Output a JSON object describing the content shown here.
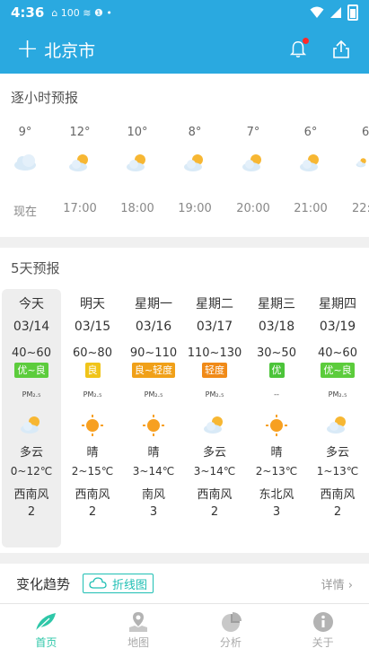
{
  "status": {
    "time": "4:36",
    "noti": "⌂ 100 ≋ ❶ •"
  },
  "header": {
    "add": "+",
    "city": "北京市"
  },
  "hourly": {
    "title": "逐小时预报",
    "items": [
      {
        "temp": "9°",
        "label": "现在",
        "icon": "cloudy-icon"
      },
      {
        "temp": "12°",
        "label": "17:00",
        "icon": "partly-cloudy-icon"
      },
      {
        "temp": "10°",
        "label": "18:00",
        "icon": "partly-cloudy-icon"
      },
      {
        "temp": "8°",
        "label": "19:00",
        "icon": "partly-cloudy-icon"
      },
      {
        "temp": "7°",
        "label": "20:00",
        "icon": "partly-cloudy-icon"
      },
      {
        "temp": "6°",
        "label": "21:00",
        "icon": "partly-cloudy-icon"
      },
      {
        "temp": "6",
        "label": "22:",
        "icon": "partly-cloudy-icon"
      }
    ]
  },
  "daily": {
    "title": "5天预报",
    "days": [
      {
        "name": "今天",
        "date": "03/14",
        "aqi": "40~60",
        "badge": "优~良",
        "badge_color": "#5ccc3c",
        "pm": "PM₂.₅",
        "icon": "partly-cloudy-icon",
        "cond": "多云",
        "temp": "0~12℃",
        "wind": "西南风",
        "level": "2"
      },
      {
        "name": "明天",
        "date": "03/15",
        "aqi": "60~80",
        "badge": "良",
        "badge_color": "#f0c419",
        "pm": "PM₂.₅",
        "icon": "sunny-icon",
        "cond": "晴",
        "temp": "2~15℃",
        "wind": "西南风",
        "level": "2"
      },
      {
        "name": "星期一",
        "date": "03/16",
        "aqi": "90~110",
        "badge": "良~轻度",
        "badge_color": "#f0a018",
        "pm": "PM₂.₅",
        "icon": "sunny-icon",
        "cond": "晴",
        "temp": "3~14℃",
        "wind": "南风",
        "level": "3"
      },
      {
        "name": "星期二",
        "date": "03/17",
        "aqi": "110~130",
        "badge": "轻度",
        "badge_color": "#f08a18",
        "pm": "PM₂.₅",
        "icon": "partly-cloudy-icon",
        "cond": "多云",
        "temp": "3~14℃",
        "wind": "西南风",
        "level": "2"
      },
      {
        "name": "星期三",
        "date": "03/18",
        "aqi": "30~50",
        "badge": "优",
        "badge_color": "#4cc43a",
        "pm": "--",
        "icon": "sunny-icon",
        "cond": "晴",
        "temp": "2~13℃",
        "wind": "东北风",
        "level": "3"
      },
      {
        "name": "星期四",
        "date": "03/19",
        "aqi": "40~60",
        "badge": "优~良",
        "badge_color": "#5ccc3c",
        "pm": "PM₂.₅",
        "icon": "partly-cloudy-icon",
        "cond": "多云",
        "temp": "1~13℃",
        "wind": "西南风",
        "level": "2"
      }
    ]
  },
  "trend": {
    "title": "变化趋势",
    "button": "折线图",
    "more": "详情 ›"
  },
  "tabs": [
    {
      "label": "首页",
      "icon": "feather-icon"
    },
    {
      "label": "地图",
      "icon": "map-pin-icon"
    },
    {
      "label": "分析",
      "icon": "pie-chart-icon"
    },
    {
      "label": "关于",
      "icon": "info-icon"
    }
  ],
  "colors": {
    "primary": "#2aa9e0",
    "accent": "#2ec7a8"
  }
}
